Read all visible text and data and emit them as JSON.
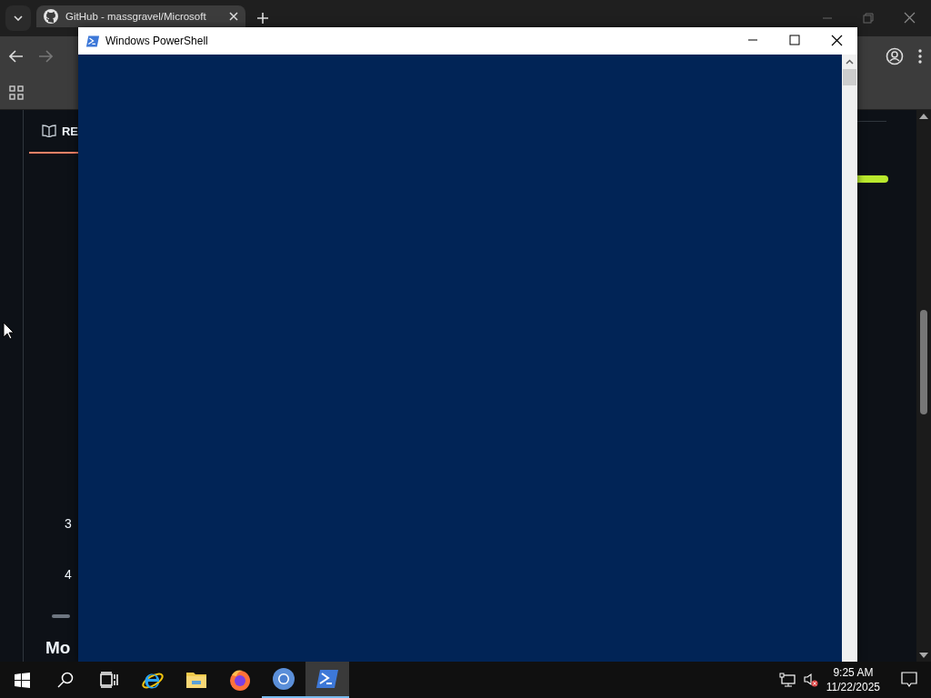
{
  "browser": {
    "tab": {
      "title": "GitHub - massgravel/Microsoft",
      "selected": true
    },
    "page": {
      "tab_label": "RE",
      "numbers": [
        "3",
        "4"
      ],
      "heading": "Mo"
    }
  },
  "powershell": {
    "title": "Windows PowerShell"
  },
  "taskbar": {
    "apps": [
      {
        "kind": "task-view",
        "running": false,
        "selected": false
      },
      {
        "kind": "edge-ie",
        "running": false,
        "selected": false
      },
      {
        "kind": "folder",
        "running": false,
        "selected": false
      },
      {
        "kind": "firefox",
        "running": false,
        "selected": false
      },
      {
        "kind": "chrome",
        "running": true,
        "selected": false
      },
      {
        "kind": "powershell",
        "running": true,
        "selected": true
      }
    ],
    "time": "9:25 AM",
    "date": "11/22/2025"
  }
}
